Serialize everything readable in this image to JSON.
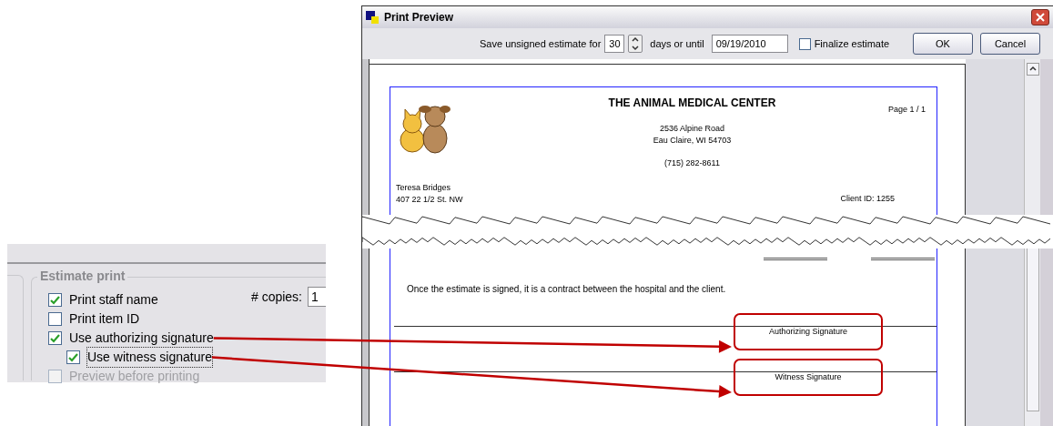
{
  "settings_panel": {
    "group_title": "Estimate print",
    "copies_label": "# copies:",
    "copies_value": "1",
    "options": [
      {
        "label": "Print staff name",
        "checked": true,
        "disabled": false,
        "focused": false
      },
      {
        "label": "Print item ID",
        "checked": false,
        "disabled": false,
        "focused": false
      },
      {
        "label": "Use authorizing signature",
        "checked": true,
        "disabled": false,
        "focused": false,
        "children": [
          {
            "label": "Use witness signature",
            "checked": true,
            "disabled": false,
            "focused": true
          }
        ]
      },
      {
        "label": "Preview before printing",
        "checked": false,
        "disabled": true,
        "focused": false
      }
    ]
  },
  "window": {
    "title": "Print Preview"
  },
  "toolbar": {
    "save_label": "Save unsigned estimate for",
    "days_value": "30",
    "days_suffix": "days or until",
    "date_value": "09/19/2010",
    "finalize": {
      "label": "Finalize estimate",
      "checked": false
    },
    "buttons": [
      "OK",
      "Cancel"
    ]
  },
  "document": {
    "clinic_name": "THE ANIMAL MEDICAL CENTER",
    "page_label": "Page 1 / 1",
    "address_lines": [
      "2536 Alpine Road",
      "Eau Claire, WI 54703"
    ],
    "phone": "(715) 282-8611",
    "client_lines": [
      "Teresa Bridges",
      "407 22 1/2 St. NW"
    ],
    "client_id": "Client ID: 1255",
    "statement": "Once the estimate is signed, it is a contract between the hospital and the client.",
    "signatures": [
      {
        "label": "Authorizing Signature",
        "highlighted": true
      },
      {
        "label": "Witness Signature",
        "highlighted": true
      }
    ]
  }
}
